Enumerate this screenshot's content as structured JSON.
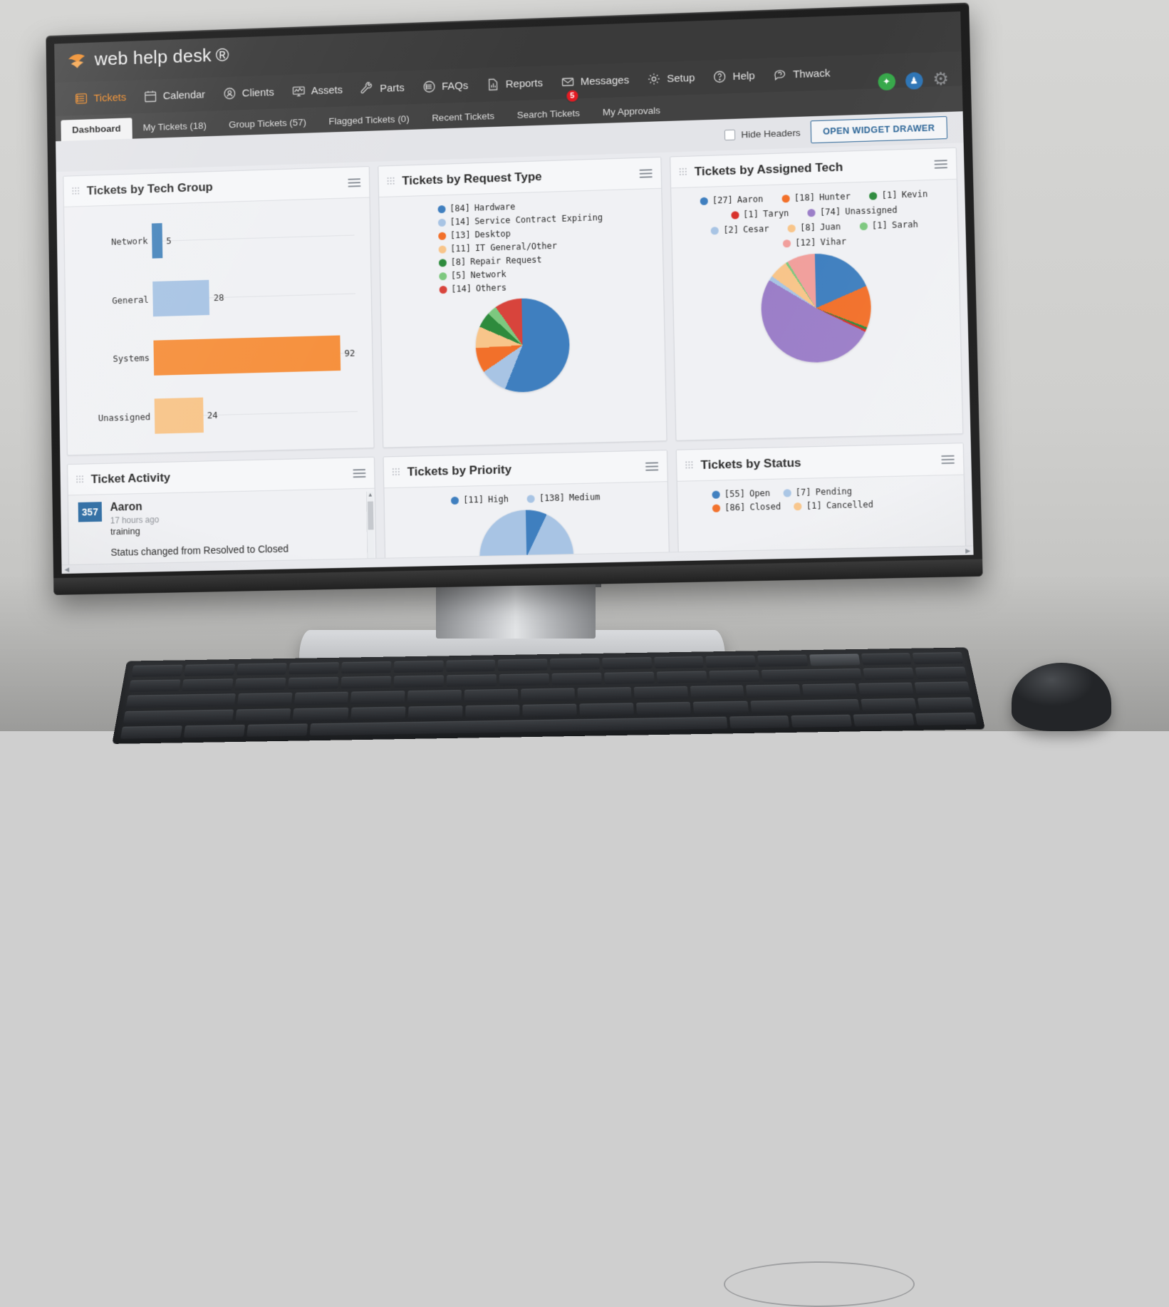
{
  "brand": {
    "name": "web help desk",
    "tm": "®"
  },
  "nav": {
    "items": [
      {
        "label": "Tickets",
        "icon": "list-icon",
        "active": true
      },
      {
        "label": "Calendar",
        "icon": "calendar-icon",
        "active": false
      },
      {
        "label": "Clients",
        "icon": "person-icon",
        "active": false
      },
      {
        "label": "Assets",
        "icon": "monitor-icon",
        "active": false
      },
      {
        "label": "Parts",
        "icon": "wrench-icon",
        "active": false
      },
      {
        "label": "FAQs",
        "icon": "faq-icon",
        "active": false
      },
      {
        "label": "Reports",
        "icon": "chart-icon",
        "active": false
      },
      {
        "label": "Messages",
        "icon": "envelope-icon",
        "active": false,
        "badge": "5"
      },
      {
        "label": "Setup",
        "icon": "gear-icon",
        "active": false
      },
      {
        "label": "Help",
        "icon": "question-icon",
        "active": false
      },
      {
        "label": "Thwack",
        "icon": "thwack-icon",
        "active": false
      }
    ],
    "right_icons": [
      {
        "name": "shield-icon",
        "glyph": "✦",
        "color": "#37a84a"
      },
      {
        "name": "avatar-icon",
        "glyph": "♟",
        "color": "#2d74b5"
      },
      {
        "name": "settings-gear-icon",
        "glyph": "⚙",
        "color": "#8d8f92"
      }
    ]
  },
  "tabs": [
    {
      "label": "Dashboard",
      "active": true
    },
    {
      "label": "My Tickets (18)",
      "active": false
    },
    {
      "label": "Group Tickets (57)",
      "active": false
    },
    {
      "label": "Flagged Tickets (0)",
      "active": false
    },
    {
      "label": "Recent Tickets",
      "active": false
    },
    {
      "label": "Search Tickets",
      "active": false
    },
    {
      "label": "My Approvals",
      "active": false
    }
  ],
  "toolbar": {
    "hide_headers_label": "Hide Headers",
    "hide_headers_checked": false,
    "open_widget_drawer_label": "OPEN WIDGET DRAWER"
  },
  "widgets": {
    "tech_group": {
      "title": "Tickets by Tech Group"
    },
    "request_type": {
      "title": "Tickets by Request Type"
    },
    "assigned_tech": {
      "title": "Tickets by Assigned Tech"
    },
    "ticket_activity": {
      "title": "Ticket Activity"
    },
    "priority": {
      "title": "Tickets by Priority"
    },
    "status": {
      "title": "Tickets by Status"
    }
  },
  "activity": {
    "ticket_number": "357",
    "user": "Aaron",
    "time": "17 hours ago",
    "subject": "training",
    "message": "Status changed from Resolved to Closed"
  },
  "chart_data": [
    {
      "id": "tech_group",
      "type": "bar",
      "title": "Tickets by Tech Group",
      "orientation": "horizontal",
      "categories": [
        "Network",
        "General",
        "Systems",
        "Unassigned"
      ],
      "values": [
        5,
        28,
        92,
        24
      ],
      "colors": [
        "#4a87bd",
        "#a8c4e4",
        "#f6903d",
        "#f8c58a"
      ],
      "xlim": [
        0,
        100
      ],
      "grid": true,
      "legend": "none"
    },
    {
      "id": "request_type",
      "type": "pie",
      "title": "Tickets by Request Type",
      "legend_position": "top",
      "labels": [
        "Hardware",
        "Service Contract Expiring",
        "Desktop",
        "IT General/Other",
        "Repair Request",
        "Network",
        "Others"
      ],
      "values": [
        84,
        14,
        13,
        11,
        8,
        5,
        14
      ],
      "colors": [
        "#3f7fbf",
        "#a8c4e4",
        "#f2702a",
        "#f8c58a",
        "#2e8b3d",
        "#7dc87f",
        "#d8443c"
      ]
    },
    {
      "id": "assigned_tech",
      "type": "pie",
      "title": "Tickets by Assigned Tech",
      "legend_position": "top",
      "labels": [
        "Aaron",
        "Hunter",
        "Kevin",
        "Taryn",
        "Unassigned",
        "Cesar",
        "Juan",
        "Sarah",
        "Vihar"
      ],
      "values": [
        27,
        18,
        1,
        1,
        74,
        2,
        8,
        1,
        12
      ],
      "colors": [
        "#3f7fbf",
        "#f2702a",
        "#2e8b3d",
        "#d8322c",
        "#9b7ec8",
        "#a8c4e4",
        "#f8c58a",
        "#7dc87f",
        "#f19f9c"
      ]
    },
    {
      "id": "priority",
      "type": "pie",
      "title": "Tickets by Priority",
      "legend_position": "top",
      "labels": [
        "High",
        "Medium"
      ],
      "values": [
        11,
        138
      ],
      "colors": [
        "#3f7fbf",
        "#a8c4e4"
      ]
    },
    {
      "id": "status",
      "type": "pie",
      "title": "Tickets by Status",
      "legend_position": "top",
      "labels": [
        "Open",
        "Pending",
        "Closed",
        "Cancelled"
      ],
      "values": [
        55,
        7,
        86,
        1
      ],
      "colors": [
        "#3f7fbf",
        "#a8c4e4",
        "#f2702a",
        "#f8c58a"
      ]
    }
  ]
}
